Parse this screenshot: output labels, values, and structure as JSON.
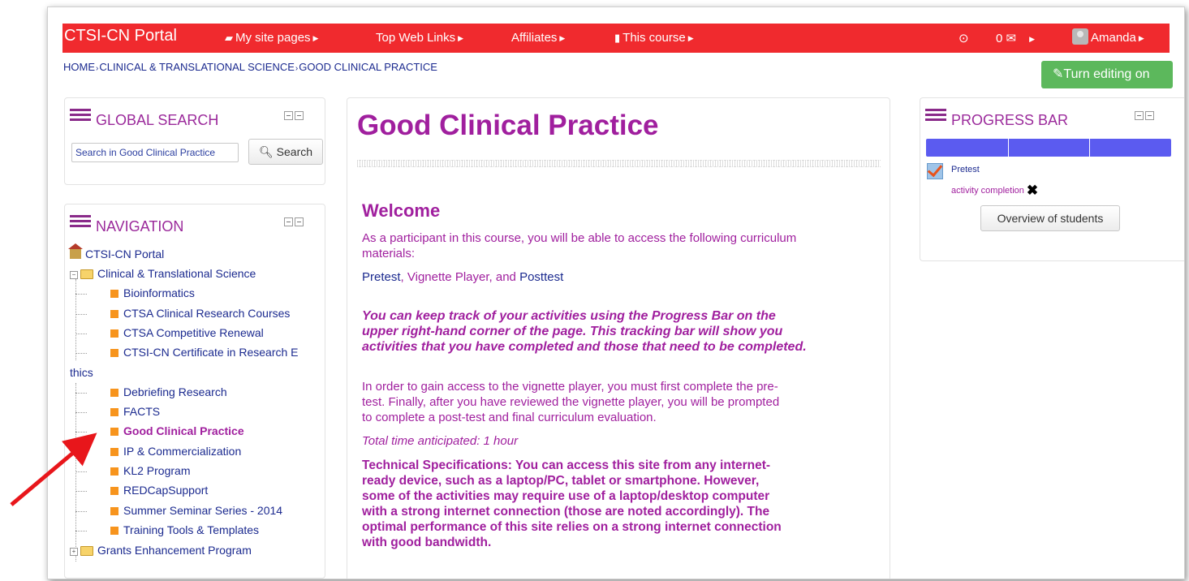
{
  "navbar": {
    "brand": "CTSI-CN Portal",
    "items": [
      {
        "label": "My site pages"
      },
      {
        "label": "Top Web Links"
      },
      {
        "label": "Affiliates"
      },
      {
        "label": "This course"
      }
    ],
    "messages_count": "0",
    "user_name": "Amanda"
  },
  "breadcrumb": {
    "items": [
      "HOME",
      "CLINICAL & TRANSLATIONAL SCIENCE",
      "GOOD CLINICAL PRACTICE"
    ]
  },
  "edit_button": {
    "label": "Turn editing on"
  },
  "global_search": {
    "title": "GLOBAL SEARCH",
    "placeholder": "Search in Good Clinical Practice",
    "button_label": "Search"
  },
  "navigation": {
    "title": "NAVIGATION",
    "root": "CTSI-CN Portal",
    "category": "Clinical & Translational Science",
    "items": [
      "Bioinformatics",
      "CTSA Clinical Research Courses",
      "CTSA Competitive Renewal",
      "CTSI-CN Certificate in Research E",
      "Debriefing Research",
      "FACTS",
      "Good Clinical Practice",
      "IP & Commercialization",
      "KL2 Program",
      "REDCapSupport",
      "Summer Seminar Series - 2014",
      "Training Tools & Templates"
    ],
    "wrap_text": "thics",
    "other_category": "Grants Enhancement Program"
  },
  "main": {
    "title": "Good Clinical Practice",
    "welcome": "Welcome",
    "intro_line1": "As a participant in this course, you will be able to access the following curriculum",
    "intro_line2": "materials:",
    "materials": {
      "pretest": "Pretest",
      "vignette": "Vignette Player",
      "and": ", and",
      "comma": ",",
      "posttest": "Posttest"
    },
    "tracking_line1": "You can keep track of your activities using the Progress Bar on the",
    "tracking_line2": "upper right-hand corner of the page.  This tracking bar will show you",
    "tracking_line3": "activities that you have completed and those that need to be completed.",
    "access_line1": "In order to gain access to the vignette player, you must first complete the pre-",
    "access_line2": "test. Finally, after you have reviewed  the vignette player, you will be prompted",
    "access_line3": "to complete a post-test and final curriculum evaluation.",
    "time": "Total time anticipated: 1 hour",
    "tech_line1": "Technical Specifications:  You can access this site from any internet-",
    "tech_line2": "ready device, such as a laptop/PC, tablet or smartphone.  However,",
    "tech_line3": "some of the activities may require use of a laptop/desktop computer",
    "tech_line4": "with a strong internet connection (those are noted accordingly).  The",
    "tech_line5": "optimal performance of this site relies on a strong internet connection",
    "tech_line6": "with good bandwidth."
  },
  "progress": {
    "title": "PROGRESS BAR",
    "segments": 3,
    "activity_name": "Pretest",
    "activity_status": "activity completion",
    "button_label": "Overview of students"
  },
  "colors": {
    "navbar": "#f02a2e",
    "accent_purple": "#a01f9e",
    "link_blue": "#1b2a8f",
    "progress_blue": "#5b5bf0",
    "edit_green": "#5cb85c",
    "annotation_arrow": "#e8161b"
  },
  "icons": {
    "navbar": [
      "briefcase-icon",
      "book-icon",
      "target-icon",
      "envelope-icon",
      "avatar"
    ],
    "blocks": [
      "hamburger-icon",
      "minimize-icon",
      "dock-icon"
    ],
    "tree": [
      "home-icon",
      "folder-icon",
      "bullet-square-icon",
      "expand-icon"
    ],
    "buttons": [
      "edit-icon",
      "search-icon",
      "check-icon",
      "cross-icon"
    ]
  }
}
